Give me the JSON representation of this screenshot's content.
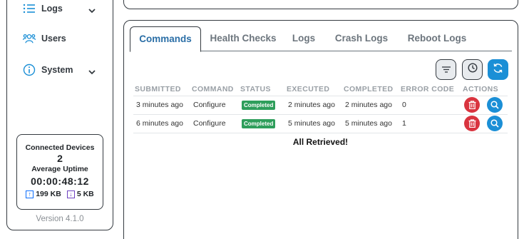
{
  "sidebar": {
    "items": [
      {
        "label": "Logs",
        "icon": "list-icon",
        "has_chevron": true
      },
      {
        "label": "Users",
        "icon": "users-icon",
        "has_chevron": false
      },
      {
        "label": "System",
        "icon": "info-circle-icon",
        "has_chevron": true
      }
    ],
    "stats": {
      "connected_label": "Connected Devices",
      "connected_value": "2",
      "uptime_label": "Average Uptime",
      "uptime_value": "00:00:48:12",
      "upload": "199 KB",
      "download": "5 KB"
    },
    "version": "Version 4.1.0"
  },
  "tabs": [
    "Commands",
    "Health Checks",
    "Logs",
    "Crash Logs",
    "Reboot Logs"
  ],
  "active_tab": "Commands",
  "toolbar": {
    "filter_icon": "filter-icon",
    "history_icon": "clock-icon",
    "refresh_icon": "refresh-icon"
  },
  "table": {
    "headers": [
      "SUBMITTED",
      "COMMAND",
      "STATUS",
      "EXECUTED",
      "COMPLETED",
      "ERROR CODE",
      "ACTIONS"
    ],
    "rows": [
      {
        "submitted": "3 minutes ago",
        "command": "Configure",
        "status": "Completed",
        "executed": "2 minutes ago",
        "completed": "2 minutes ago",
        "error_code": "0"
      },
      {
        "submitted": "6 minutes ago",
        "command": "Configure",
        "status": "Completed",
        "executed": "5 minutes ago",
        "completed": "5 minutes ago",
        "error_code": "1"
      }
    ],
    "footer": "All Retrieved!"
  },
  "colors": {
    "accent": "#1b8fd6",
    "active_tab_text": "#2a6ea6",
    "status_completed": "#2e9e5b",
    "delete": "#d9343f"
  }
}
